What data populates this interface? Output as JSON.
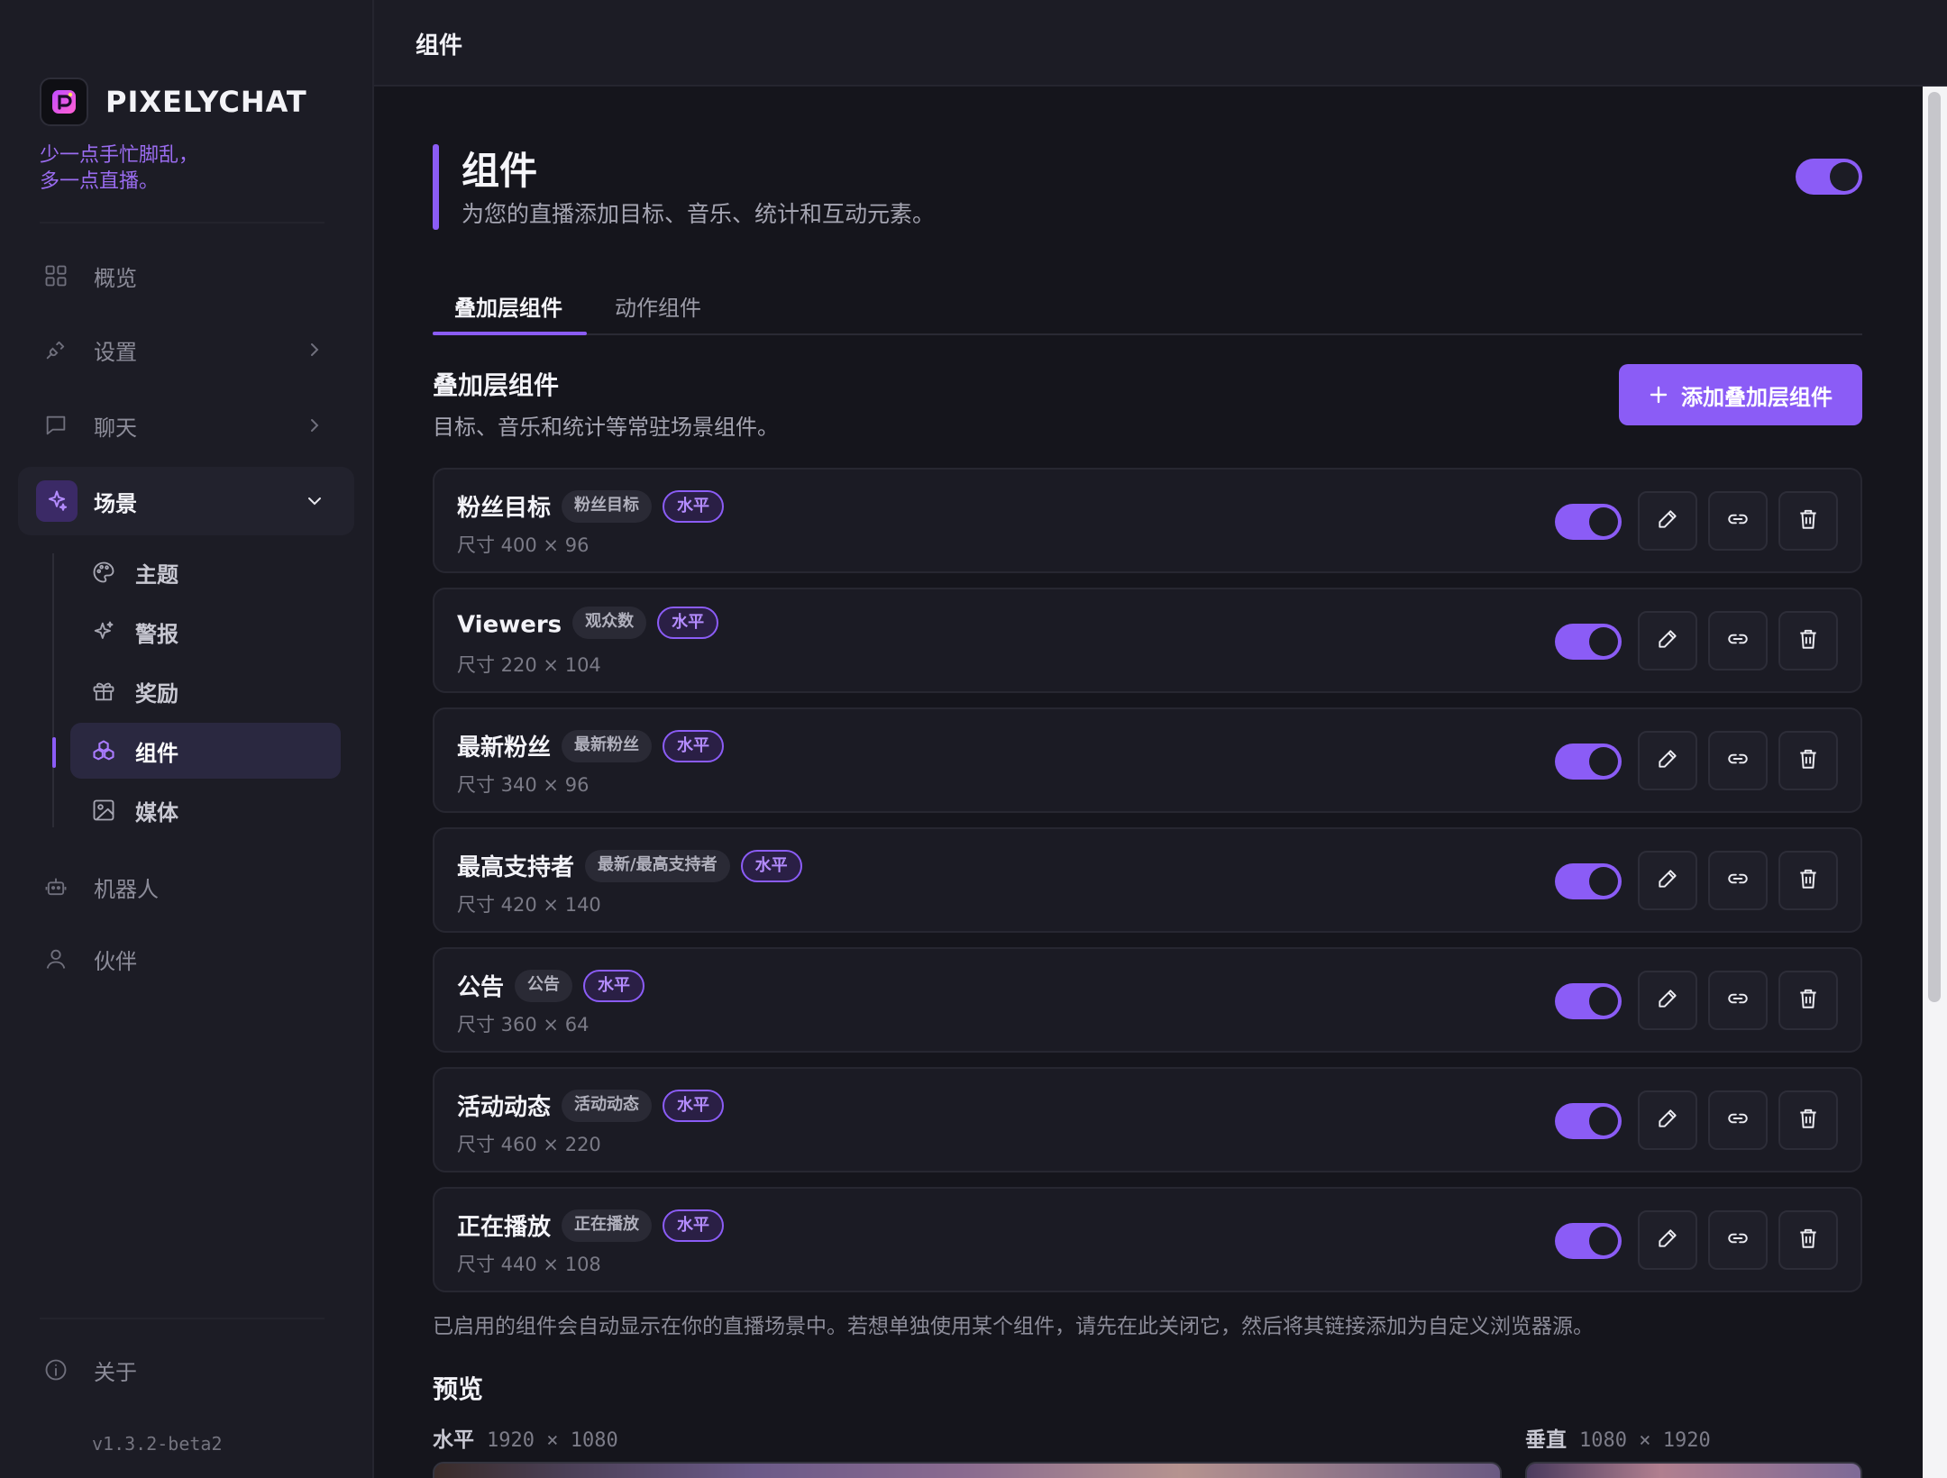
{
  "brand": {
    "name": "PIXELYCHAT",
    "tagline": "少一点手忙脚乱，\n多一点直播。"
  },
  "nav": {
    "overview": "概览",
    "settings": "设置",
    "chat": "聊天",
    "scenes": "场景",
    "bots": "机器人",
    "partners": "伙伴",
    "about": "关于"
  },
  "scene_subnav": [
    {
      "label": "主题",
      "icon": "palette-icon"
    },
    {
      "label": "警报",
      "icon": "sparkle-icon"
    },
    {
      "label": "奖励",
      "icon": "gift-icon"
    },
    {
      "label": "组件",
      "icon": "components-icon",
      "active": true
    },
    {
      "label": "媒体",
      "icon": "image-icon"
    }
  ],
  "version": "v1.3.2-beta2",
  "header": {
    "title": "组件"
  },
  "hero": {
    "title": "组件",
    "subtitle": "为您的直播添加目标、音乐、统计和互动元素。",
    "enabled": true
  },
  "tabs": {
    "overlay": "叠加层组件",
    "action": "动作组件",
    "active": "overlay"
  },
  "section": {
    "title": "叠加层组件",
    "subtitle": "目标、音乐和统计等常驻场景组件。",
    "add_button": "添加叠加层组件"
  },
  "widgets": [
    {
      "name": "粉丝目标",
      "tag": "粉丝目标",
      "orientation": "水平",
      "size": "尺寸 400 × 96",
      "enabled": true
    },
    {
      "name": "Viewers",
      "tag": "观众数",
      "orientation": "水平",
      "size": "尺寸 220 × 104",
      "enabled": true
    },
    {
      "name": "最新粉丝",
      "tag": "最新粉丝",
      "orientation": "水平",
      "size": "尺寸 340 × 96",
      "enabled": true
    },
    {
      "name": "最高支持者",
      "tag": "最新/最高支持者",
      "orientation": "水平",
      "size": "尺寸 420 × 140",
      "enabled": true
    },
    {
      "name": "公告",
      "tag": "公告",
      "orientation": "水平",
      "size": "尺寸 360 × 64",
      "enabled": true
    },
    {
      "name": "活动动态",
      "tag": "活动动态",
      "orientation": "水平",
      "size": "尺寸 460 × 220",
      "enabled": true
    },
    {
      "name": "正在播放",
      "tag": "正在播放",
      "orientation": "水平",
      "size": "尺寸 440 × 108",
      "enabled": true
    }
  ],
  "footnote": "已启用的组件会自动显示在你的直播场景中。若想单独使用某个组件，请先在此关闭它，然后将其链接添加为自定义浏览器源。",
  "preview": {
    "title": "预览",
    "horizontal": {
      "label": "水平",
      "dims": "1920 × 1080"
    },
    "vertical": {
      "label": "垂直",
      "dims": "1080 × 1920"
    }
  },
  "colors": {
    "accent": "#8b5cf6",
    "background": "#15151c",
    "sidebar": "#1c1c25",
    "card": "#1b1b24"
  }
}
